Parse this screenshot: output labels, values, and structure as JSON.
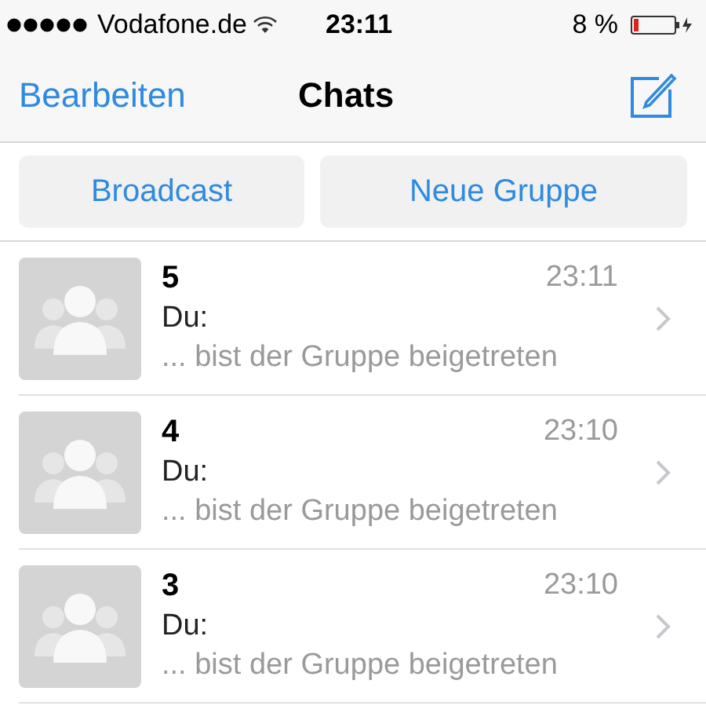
{
  "status_bar": {
    "carrier": "Vodafone.de",
    "time": "23:11",
    "battery": "8 %"
  },
  "nav": {
    "left": "Bearbeiten",
    "title": "Chats"
  },
  "actions": [
    "Broadcast",
    "Neue Gruppe"
  ],
  "chats": [
    {
      "name": "5",
      "time": "23:11",
      "sender": "Du:",
      "message": "... bist der Gruppe beigetreten"
    },
    {
      "name": "4",
      "time": "23:10",
      "sender": "Du:",
      "message": "... bist der Gruppe beigetreten"
    },
    {
      "name": "3",
      "time": "23:10",
      "sender": "Du:",
      "message": "... bist der Gruppe beigetreten"
    }
  ]
}
